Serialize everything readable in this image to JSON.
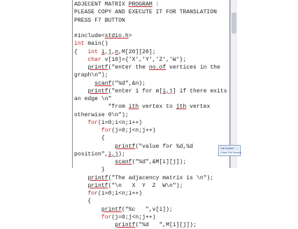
{
  "document": {
    "lines": [
      {
        "segments": [
          {
            "text": "ADJECENT MATRIX ",
            "style": ""
          },
          {
            "text": "PROGRAM",
            "style": "u"
          },
          {
            "text": " :",
            "style": ""
          }
        ]
      },
      {
        "segments": [
          {
            "text": "PLEASE COPY AND EXECUTE IT FOR TRANSLATION",
            "style": ""
          }
        ]
      },
      {
        "segments": [
          {
            "text": "PRESS F7 BUTTON",
            "style": ""
          }
        ]
      },
      {
        "segments": [
          {
            "text": "",
            "style": ""
          }
        ]
      },
      {
        "segments": [
          {
            "text": "#include<",
            "style": ""
          },
          {
            "text": "stdio.h",
            "style": "u"
          },
          {
            "text": ">",
            "style": ""
          }
        ]
      },
      {
        "segments": [
          {
            "text": "int",
            "style": "r"
          },
          {
            "text": " main()",
            "style": ""
          }
        ]
      },
      {
        "segments": [
          {
            "text": "{   ",
            "style": ""
          },
          {
            "text": "int",
            "style": "r"
          },
          {
            "text": " ",
            "style": ""
          },
          {
            "text": "i",
            "style": "u"
          },
          {
            "text": ",",
            "style": ""
          },
          {
            "text": "j",
            "style": "u"
          },
          {
            "text": ",",
            "style": ""
          },
          {
            "text": "n",
            "style": "u"
          },
          {
            "text": ",M[20][20];",
            "style": ""
          }
        ]
      },
      {
        "segments": [
          {
            "text": "    ",
            "style": ""
          },
          {
            "text": "char",
            "style": "r"
          },
          {
            "text": " v[10]={'X','Y','Z','W'};",
            "style": ""
          }
        ]
      },
      {
        "segments": [
          {
            "text": "    ",
            "style": ""
          },
          {
            "text": "printf",
            "style": "u"
          },
          {
            "text": "(\"enter the ",
            "style": ""
          },
          {
            "text": "no.of",
            "style": "u"
          },
          {
            "text": " vertices in the",
            "style": ""
          }
        ]
      },
      {
        "segments": [
          {
            "text": "graph\\n\");",
            "style": ""
          }
        ]
      },
      {
        "segments": [
          {
            "text": "      ",
            "style": ""
          },
          {
            "text": "scanf",
            "style": "u"
          },
          {
            "text": "(\"%d\",&n);",
            "style": ""
          }
        ]
      },
      {
        "segments": [
          {
            "text": "    ",
            "style": ""
          },
          {
            "text": "printf",
            "style": "u"
          },
          {
            "text": "(\"enter 1 for m[",
            "style": ""
          },
          {
            "text": "i,j",
            "style": "u"
          },
          {
            "text": "] if there exits",
            "style": ""
          }
        ]
      },
      {
        "segments": [
          {
            "text": "an edge \\n\"",
            "style": ""
          }
        ]
      },
      {
        "segments": [
          {
            "text": "          \"from ",
            "style": ""
          },
          {
            "text": "ith",
            "style": "u"
          },
          {
            "text": " vertex to ",
            "style": ""
          },
          {
            "text": "jth",
            "style": "u"
          },
          {
            "text": " vertex",
            "style": ""
          }
        ]
      },
      {
        "segments": [
          {
            "text": "otherwise 0\\n\");",
            "style": ""
          }
        ]
      },
      {
        "segments": [
          {
            "text": "    ",
            "style": ""
          },
          {
            "text": "for",
            "style": "r"
          },
          {
            "text": "(i=0;i<n;i++)",
            "style": ""
          }
        ]
      },
      {
        "segments": [
          {
            "text": "        ",
            "style": ""
          },
          {
            "text": "for",
            "style": "r"
          },
          {
            "text": "(j=0;j<n;j++)",
            "style": ""
          }
        ]
      },
      {
        "segments": [
          {
            "text": "        {",
            "style": ""
          }
        ]
      },
      {
        "segments": [
          {
            "text": "            ",
            "style": ""
          },
          {
            "text": "printf",
            "style": "u"
          },
          {
            "text": "(\"value for %d,%d",
            "style": ""
          }
        ]
      },
      {
        "segments": [
          {
            "text": "position\",",
            "style": ""
          },
          {
            "text": "i,j",
            "style": "u"
          },
          {
            "text": ");",
            "style": ""
          }
        ]
      },
      {
        "segments": [
          {
            "text": "            ",
            "style": ""
          },
          {
            "text": "scanf",
            "style": "u"
          },
          {
            "text": "(\"%d\",&M[i][j]);",
            "style": ""
          }
        ]
      },
      {
        "segments": [
          {
            "text": "        }",
            "style": ""
          }
        ]
      },
      {
        "segments": [
          {
            "text": "    ",
            "style": ""
          },
          {
            "text": "printf",
            "style": "u"
          },
          {
            "text": "(\"The adjacency matrix is \\n\");",
            "style": ""
          }
        ]
      },
      {
        "segments": [
          {
            "text": "    ",
            "style": ""
          },
          {
            "text": "printf",
            "style": "u"
          },
          {
            "text": "(\"\\n   X  Y  Z  W\\n\");",
            "style": ""
          }
        ]
      },
      {
        "segments": [
          {
            "text": "    ",
            "style": ""
          },
          {
            "text": "for",
            "style": "r"
          },
          {
            "text": "(i=0;i<n;i++)",
            "style": ""
          }
        ]
      },
      {
        "segments": [
          {
            "text": "    {",
            "style": ""
          }
        ]
      },
      {
        "segments": [
          {
            "text": "        ",
            "style": ""
          },
          {
            "text": "printf",
            "style": "u"
          },
          {
            "text": "(\"%c   \",v[i]);",
            "style": ""
          }
        ]
      },
      {
        "segments": [
          {
            "text": "        ",
            "style": ""
          },
          {
            "text": "for",
            "style": "r"
          },
          {
            "text": "(j=0;j<n;j++)",
            "style": ""
          }
        ]
      },
      {
        "segments": [
          {
            "text": "            ",
            "style": ""
          },
          {
            "text": "printf",
            "style": "u"
          },
          {
            "text": "(\"%d   \",M[i][j]);",
            "style": ""
          }
        ]
      }
    ]
  },
  "popup": {
    "items": [
      {
        "label": "Full Screen"
      },
      {
        "label": "Close Full Screen"
      }
    ]
  }
}
